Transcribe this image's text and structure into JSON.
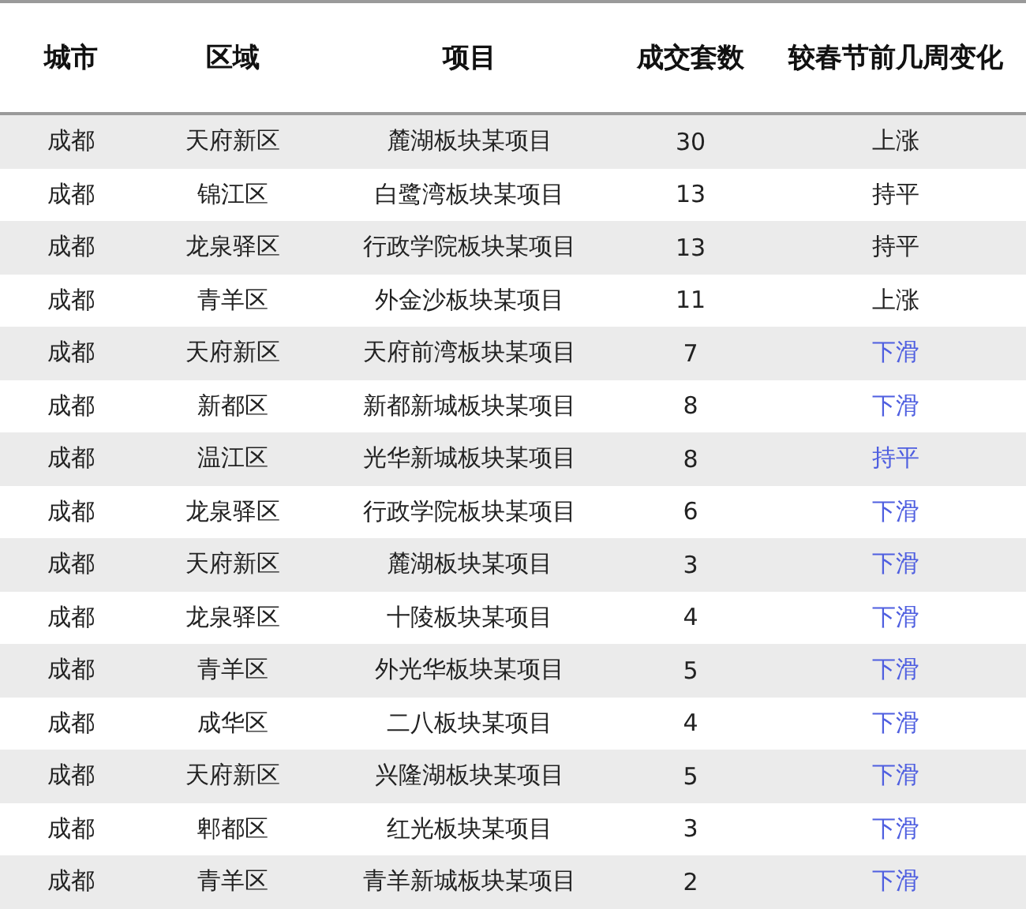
{
  "table": {
    "columns": [
      "城市",
      "区域",
      "项目",
      "成交套数",
      "较春节前几周变化"
    ],
    "rows": [
      {
        "city": "成都",
        "district": "天府新区",
        "project": "麓湖板块某项目",
        "sales": "30",
        "change": "上涨",
        "color": "#222222"
      },
      {
        "city": "成都",
        "district": "锦江区",
        "project": "白鹭湾板块某项目",
        "sales": "13",
        "change": "持平",
        "color": "#222222"
      },
      {
        "city": "成都",
        "district": "龙泉驿区",
        "project": "行政学院板块某项目",
        "sales": "13",
        "change": "持平",
        "color": "#222222"
      },
      {
        "city": "成都",
        "district": "青羊区",
        "project": "外金沙板块某项目",
        "sales": "11",
        "change": "上涨",
        "color": "#222222"
      },
      {
        "city": "成都",
        "district": "天府新区",
        "project": "天府前湾板块某项目",
        "sales": "7",
        "change": "下滑",
        "color": "#4f5fe0"
      },
      {
        "city": "成都",
        "district": "新都区",
        "project": "新都新城板块某项目",
        "sales": "8",
        "change": "下滑",
        "color": "#4f5fe0"
      },
      {
        "city": "成都",
        "district": "温江区",
        "project": "光华新城板块某项目",
        "sales": "8",
        "change": "持平",
        "color": "#4f5fe0"
      },
      {
        "city": "成都",
        "district": "龙泉驿区",
        "project": "行政学院板块某项目",
        "sales": "6",
        "change": "下滑",
        "color": "#4f5fe0"
      },
      {
        "city": "成都",
        "district": "天府新区",
        "project": "麓湖板块某项目",
        "sales": "3",
        "change": "下滑",
        "color": "#4f5fe0"
      },
      {
        "city": "成都",
        "district": "龙泉驿区",
        "project": "十陵板块某项目",
        "sales": "4",
        "change": "下滑",
        "color": "#4f5fe0"
      },
      {
        "city": "成都",
        "district": "青羊区",
        "project": "外光华板块某项目",
        "sales": "5",
        "change": "下滑",
        "color": "#4f5fe0"
      },
      {
        "city": "成都",
        "district": "成华区",
        "project": "二八板块某项目",
        "sales": "4",
        "change": "下滑",
        "color": "#4f5fe0"
      },
      {
        "city": "成都",
        "district": "天府新区",
        "project": "兴隆湖板块某项目",
        "sales": "5",
        "change": "下滑",
        "color": "#4f5fe0"
      },
      {
        "city": "成都",
        "district": "郫都区",
        "project": "红光板块某项目",
        "sales": "3",
        "change": "下滑",
        "color": "#4f5fe0"
      },
      {
        "city": "成都",
        "district": "青羊区",
        "project": "青羊新城板块某项目",
        "sales": "2",
        "change": "下滑",
        "color": "#4f5fe0"
      }
    ]
  }
}
